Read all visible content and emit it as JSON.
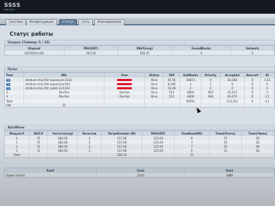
{
  "logo": {
    "brand": "SSSS",
    "sub": "VNISH"
  },
  "tabs": [
    {
      "label": "Система"
    },
    {
      "label": "Конфигурация"
    },
    {
      "label": "Статус"
    },
    {
      "label": "Сеть"
    },
    {
      "label": "Клонирование"
    }
  ],
  "page_title": "Статус работы",
  "summary": {
    "title": "Сводка (Таймер: 5 / 15)",
    "headers": [
      "Elapsed",
      "MH/S(RT)",
      "MH/S(avg)",
      "FoundBlocks",
      "Getwork"
    ],
    "row": [
      "3d13h41m32s",
      "503.04",
      "502.57",
      "0",
      "0"
    ]
  },
  "pools": {
    "title": "Пулы",
    "headers": [
      "Pool",
      "URL",
      "User",
      "Status",
      "Diff",
      "GetWorks",
      "Priority",
      "Accepted",
      "Nonce#",
      "DI"
    ],
    "rows": [
      [
        "0",
        "stratum+tcp://ltc.tupool.pro:3333",
        "",
        "Alive",
        "65.56",
        "16873",
        "0",
        "34,288",
        "0",
        "1,53"
      ],
      [
        "1",
        "stratum+tcp://ltc.tupool.pro:443",
        "",
        "Alive",
        "8,196",
        "1",
        "1",
        "0",
        "0",
        "0"
      ],
      [
        "2",
        "stratum+tcp://ltc.viabtc.io:3333",
        "",
        "Alive",
        "16.48",
        "2",
        "2",
        "0",
        "0",
        "0"
      ],
      [
        "3",
        "DevFee",
        "DevFee",
        "Alive",
        "512",
        "4800",
        "992",
        "43,313",
        "0",
        "2"
      ],
      [
        "4",
        "DevFee",
        "DevFee",
        "Alive",
        "512",
        "4809",
        "994",
        "49,474",
        "0",
        "2,1"
      ],
      [
        "Total",
        "",
        "",
        "",
        "",
        "26591",
        "",
        "133,252",
        "0",
        "4,1"
      ],
      [
        "HW",
        "31",
        "",
        "",
        "",
        "",
        "",
        "",
        "",
        ""
      ]
    ]
  },
  "asic": {
    "title": "AsicMiner",
    "headers": [
      "Модуль#",
      "ASIC#",
      "Частота(avg)",
      "Вольтаж",
      "Потребление (W)",
      "MH/S(RT)",
      "Ошибки(HW)",
      "Темп(Плата)",
      "Темп(Чипы)"
    ],
    "rows": [
      [
        "0",
        "72",
        "384.00",
        "2",
        "157.06",
        "125.00",
        "8",
        "57",
        "65"
      ],
      [
        "1",
        "72",
        "384.00",
        "2",
        "157.06",
        "125.00",
        "7",
        "53",
        "61"
      ],
      [
        "2",
        "72",
        "384.00",
        "2",
        "157.06",
        "125.00",
        "7",
        "55",
        "66"
      ],
      [
        "3",
        "72",
        "384.00",
        "2",
        "157.06",
        "125.00",
        "9",
        "53",
        "62"
      ],
      [
        "Total",
        "",
        "",
        "",
        "628.24",
        "",
        "31",
        "",
        ""
      ]
    ]
  },
  "fans": {
    "headers": [
      "Fan#",
      "Fan1",
      "Fan2"
    ],
    "rows": [
      [
        "Speed (r/min)",
        "2220",
        "2880"
      ]
    ]
  }
}
